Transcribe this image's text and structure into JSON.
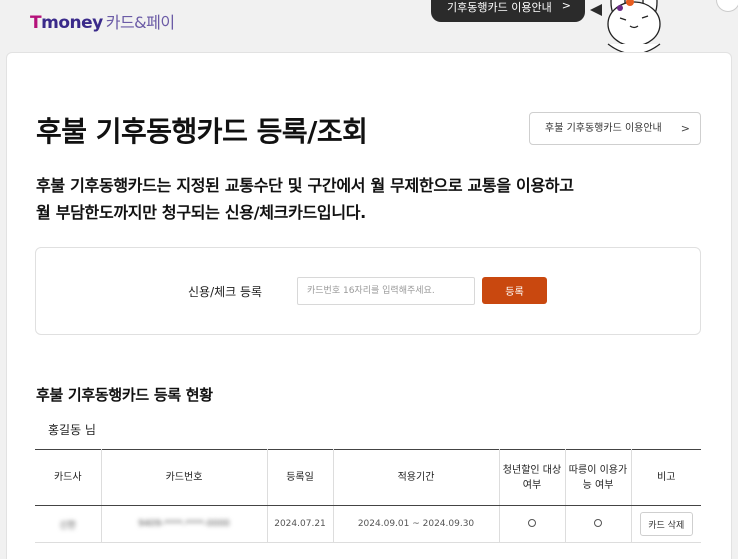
{
  "header": {
    "logo_t": "T",
    "logo_money": "money",
    "logo_sub": "카드&페이",
    "guide_bubble": "기후동행카드 이용안내"
  },
  "main": {
    "title": "후불 기후동행카드 등록/조회",
    "guide_button": "후불 기후동행카드 이용안내",
    "desc_line1": "후불 기후동행카드는 지정된 교통수단 및 구간에서 월 무제한으로 교통을 이용하고",
    "desc_line2": "월 부담한도까지만 청구되는 신용/체크카드입니다."
  },
  "register": {
    "label": "신용/체크 등록",
    "placeholder": "카드번호 16자리를 입력해주세요.",
    "button": "등록"
  },
  "status": {
    "title": "후불 기후동행카드 등록 현황",
    "user": "홍길동 님",
    "columns": [
      "카드사",
      "카드번호",
      "등록일",
      "적용기간",
      "청년할인 대상 여부",
      "따릉이 이용가능 여부",
      "비고"
    ],
    "rows": [
      {
        "issuer": "신한",
        "card_no": "9409-****-****-0000",
        "reg_date": "2024.07.21",
        "period": "2024.09.01 ~ 2024.09.30",
        "delete": "카드 삭제"
      }
    ]
  },
  "colors": {
    "accent": "#c9480f",
    "logo_pink": "#b5117a",
    "logo_navy": "#3a2a8a"
  }
}
